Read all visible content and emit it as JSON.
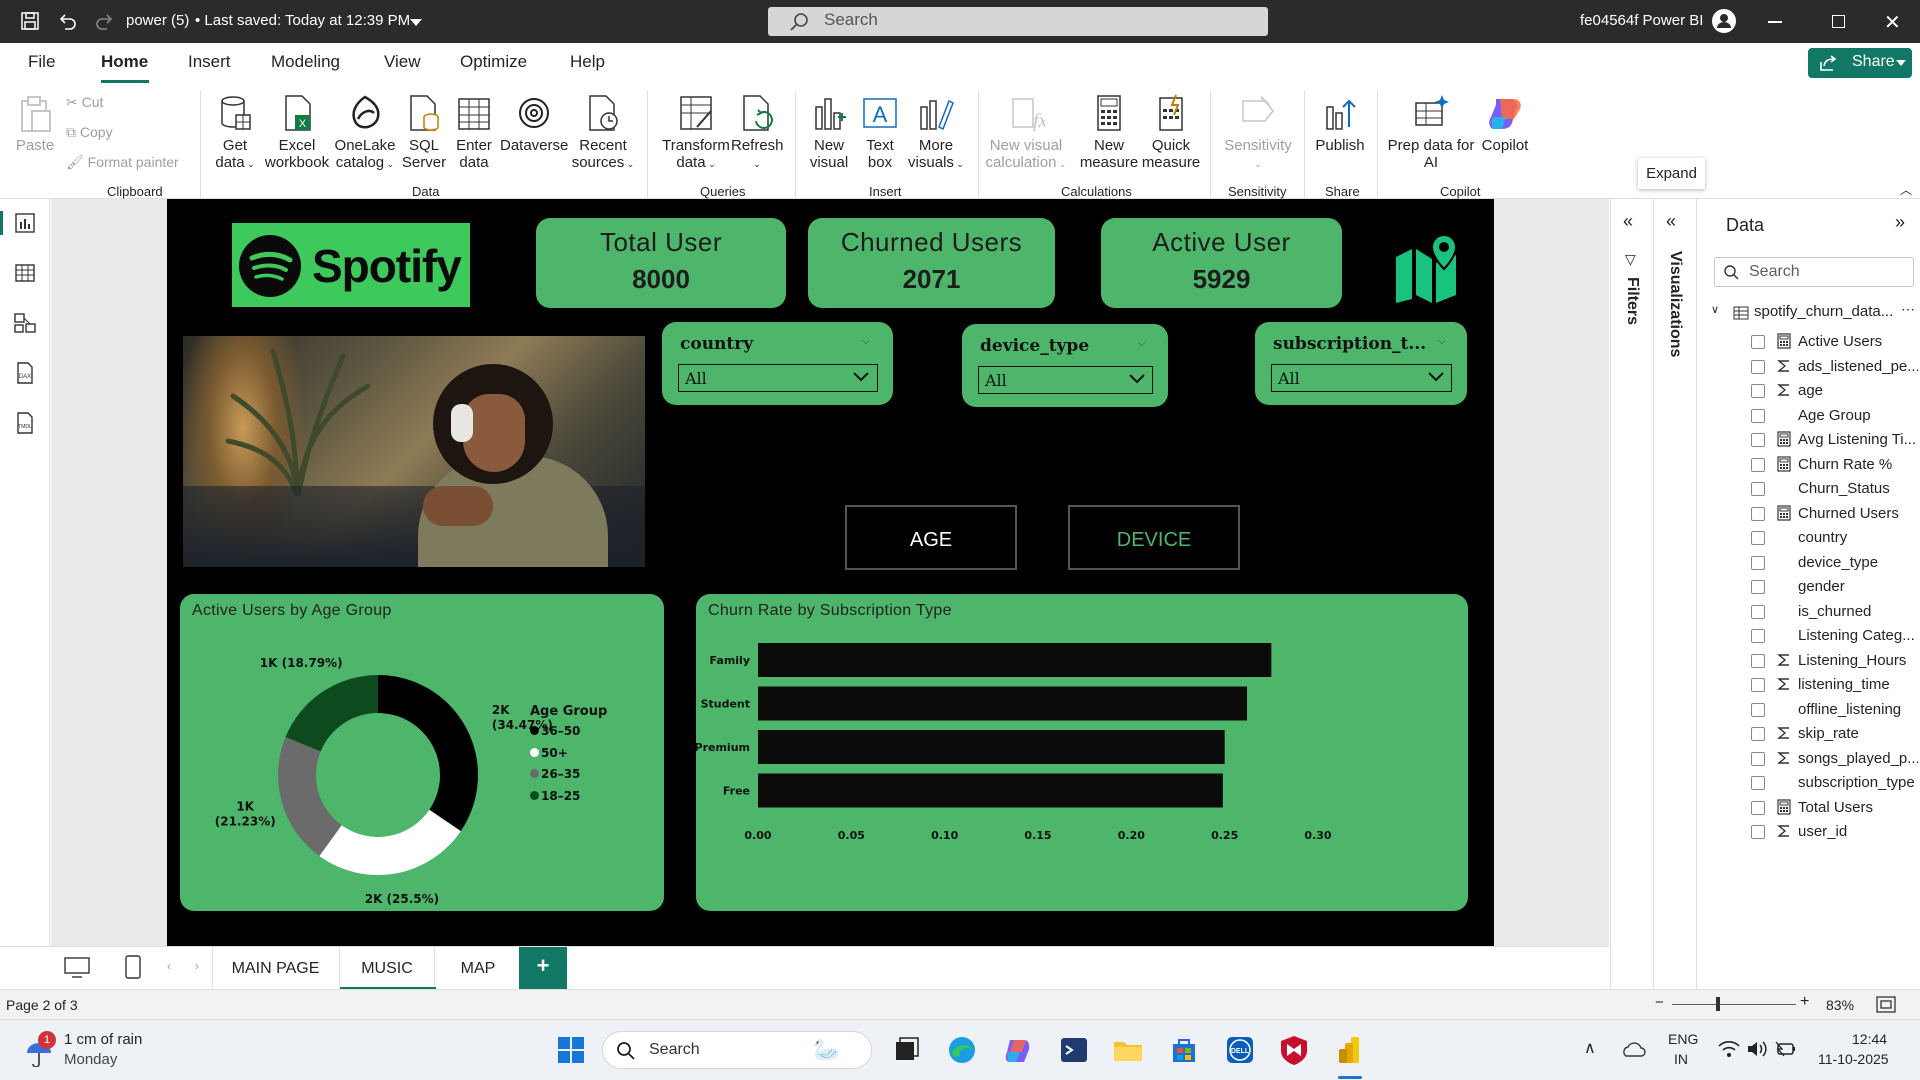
{
  "titlebar": {
    "doc_title": "power (5)",
    "saved_status": "• Last saved: Today at 12:39 PM",
    "search_placeholder": "Search",
    "account": "fe04564f Power BI"
  },
  "menu": [
    "File",
    "Home",
    "Insert",
    "Modeling",
    "View",
    "Optimize",
    "Help"
  ],
  "share_label": "Share",
  "ribbon": {
    "clipboard": {
      "paste": "Paste",
      "cut": "Cut",
      "copy": "Copy",
      "format_painter": "Format painter",
      "group": "Clipboard"
    },
    "data": {
      "get_data": [
        "Get",
        "data"
      ],
      "excel": [
        "Excel",
        "workbook"
      ],
      "onelake": [
        "OneLake",
        "catalog"
      ],
      "sql": [
        "SQL",
        "Server"
      ],
      "enter": [
        "Enter",
        "data"
      ],
      "dataverse": [
        "Dataverse",
        ""
      ],
      "recent": [
        "Recent",
        "sources"
      ],
      "group": "Data"
    },
    "queries": {
      "transform": [
        "Transform",
        "data"
      ],
      "refresh": [
        "Refresh",
        ""
      ],
      "group": "Queries"
    },
    "insert": {
      "new_visual": [
        "New",
        "visual"
      ],
      "text_box": [
        "Text",
        "box"
      ],
      "more_visuals": [
        "More",
        "visuals"
      ],
      "group": "Insert"
    },
    "calculations": {
      "new_visual_calc": [
        "New visual",
        "calculation"
      ],
      "new_measure": [
        "New",
        "measure"
      ],
      "quick_measure": [
        "Quick",
        "measure"
      ],
      "group": "Calculations"
    },
    "sensitivity": {
      "label": "Sensitivity",
      "group": "Sensitivity"
    },
    "share": {
      "publish": "Publish",
      "group": "Share"
    },
    "copilot": {
      "prep": [
        "Prep data for",
        "AI"
      ],
      "copilot": "Copilot",
      "group": "Copilot"
    }
  },
  "report": {
    "logo_text": "Spotify",
    "cards": [
      {
        "title": "Total User",
        "value": "8000"
      },
      {
        "title": "Churned Users",
        "value": "2071"
      },
      {
        "title": "Active User",
        "value": "5929"
      }
    ],
    "slicers": [
      {
        "label": "country",
        "value": "All"
      },
      {
        "label": "device_type",
        "value": "All"
      },
      {
        "label": "subscription_t...",
        "value": "All"
      }
    ],
    "nav_buttons": [
      "AGE",
      "DEVICE"
    ]
  },
  "chart_data": [
    {
      "type": "pie",
      "title": "Active Users by Age Group",
      "legend_title": "Age Group",
      "legend_position": "right",
      "categories": [
        "36–50",
        "50+",
        "26–35",
        "18–25"
      ],
      "values": [
        34.47,
        25.5,
        21.23,
        18.79
      ],
      "data_labels": [
        "2K (34.47%)",
        "2K (25.5%)",
        "1K (21.23%)",
        "1K (18.79%)"
      ],
      "colors": [
        "#000000",
        "#ffffff",
        "#6b6b6b",
        "#0d4a1d"
      ]
    },
    {
      "type": "bar",
      "orientation": "horizontal",
      "title": "Churn Rate by Subscription Type",
      "categories": [
        "Family",
        "Student",
        "Premium",
        "Free"
      ],
      "values": [
        0.275,
        0.262,
        0.25,
        0.249
      ],
      "xlim": [
        0,
        0.3
      ],
      "xticks": [
        "0.00",
        "0.05",
        "0.10",
        "0.15",
        "0.20",
        "0.25",
        "0.30"
      ],
      "bar_color": "#0b0b0b",
      "grid": false
    }
  ],
  "pages": {
    "tabs": [
      "MAIN PAGE",
      "MUSIC",
      "MAP"
    ],
    "active": "MUSIC",
    "add": "+"
  },
  "status": {
    "page": "Page 2 of 3",
    "zoom": "83%"
  },
  "panes": {
    "filters": "Filters",
    "visualizations": "Visualizations",
    "tooltip": "Expand"
  },
  "data_pane": {
    "title": "Data",
    "search_placeholder": "Search",
    "table": "spotify_churn_data...",
    "fields": [
      {
        "name": "Active Users",
        "icon": "calc"
      },
      {
        "name": "ads_listened_pe...",
        "icon": "sigma"
      },
      {
        "name": "age",
        "icon": "sigma"
      },
      {
        "name": "Age Group",
        "icon": "none"
      },
      {
        "name": "Avg Listening Ti...",
        "icon": "calc"
      },
      {
        "name": "Churn Rate %",
        "icon": "calc"
      },
      {
        "name": "Churn_Status",
        "icon": "none"
      },
      {
        "name": "Churned Users",
        "icon": "calc"
      },
      {
        "name": "country",
        "icon": "none"
      },
      {
        "name": "device_type",
        "icon": "none"
      },
      {
        "name": "gender",
        "icon": "none"
      },
      {
        "name": "is_churned",
        "icon": "none"
      },
      {
        "name": "Listening Categ...",
        "icon": "none"
      },
      {
        "name": "Listening_Hours",
        "icon": "sigma"
      },
      {
        "name": "listening_time",
        "icon": "sigma"
      },
      {
        "name": "offline_listening",
        "icon": "none"
      },
      {
        "name": "skip_rate",
        "icon": "sigma"
      },
      {
        "name": "songs_played_p...",
        "icon": "sigma"
      },
      {
        "name": "subscription_type",
        "icon": "none"
      },
      {
        "name": "Total Users",
        "icon": "calc"
      },
      {
        "name": "user_id",
        "icon": "sigma"
      }
    ]
  },
  "taskbar": {
    "weather": "1 cm of rain",
    "day": "Monday",
    "weather_badge": "1",
    "search": "Search",
    "lang1": "ENG",
    "lang2": "IN",
    "time": "12:44",
    "date": "11-10-2025"
  }
}
